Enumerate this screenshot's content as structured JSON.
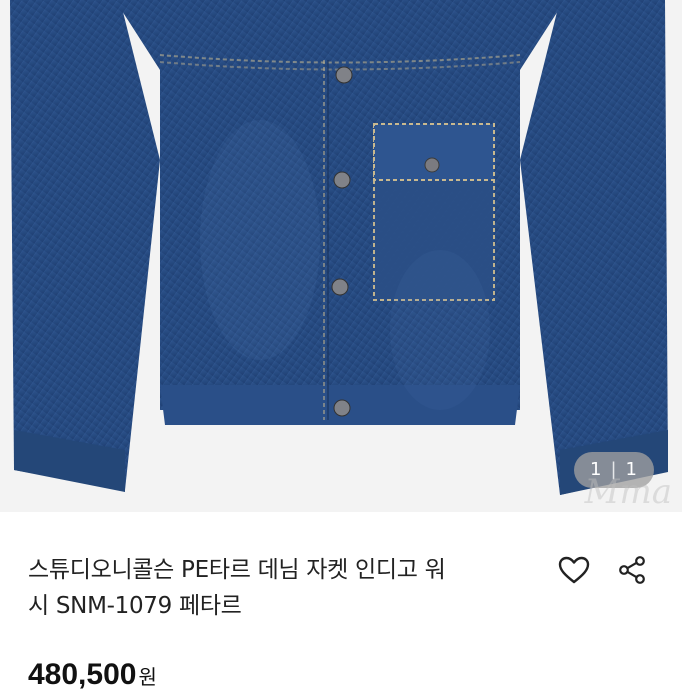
{
  "product": {
    "title_line1": "스튜디오니콜슨 PE타르 데님 자켓 인디고 워",
    "title_line2": "시 SNM-1079 페타르",
    "price": "480,500",
    "currency": "원"
  },
  "gallery": {
    "current": "1",
    "total": "1",
    "watermark": "Mma"
  },
  "icons": {
    "wishlist": "heart-icon",
    "share": "share-icon"
  },
  "colors": {
    "denim": "#2c4f84",
    "text": "#222222",
    "background": "#ffffff"
  }
}
